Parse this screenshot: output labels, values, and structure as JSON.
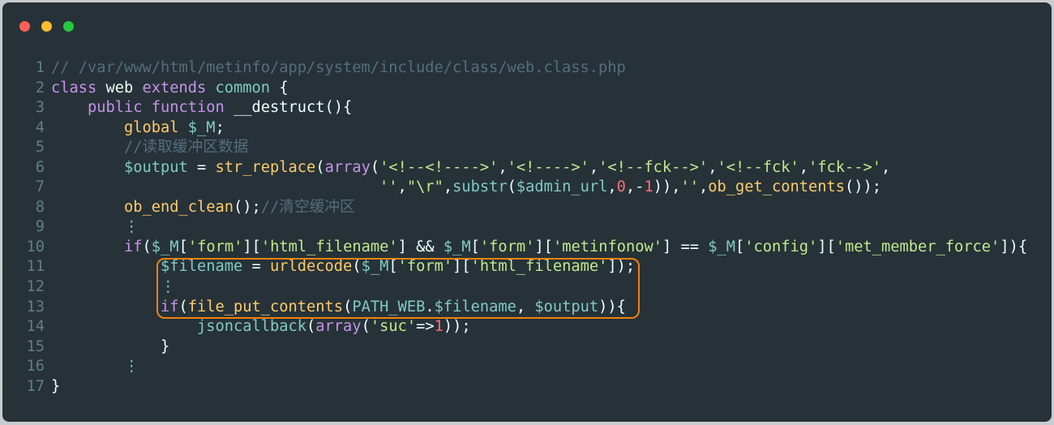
{
  "window": {
    "controls": [
      "close",
      "minimize",
      "maximize"
    ]
  },
  "colors": {
    "background": "#263238",
    "keyword": "#c792ea",
    "function": "#ffcb6b",
    "variable": "#80cbc4",
    "string": "#c3e88d",
    "number": "#f07178",
    "comment": "#546e7a",
    "highlight_box": "#f0820f"
  },
  "code": {
    "lines": [
      {
        "n": "1",
        "tokens": [
          [
            "cm",
            "// /var/www/html/metinfo/app/system/include/class/web.class.php"
          ]
        ]
      },
      {
        "n": "2",
        "tokens": [
          [
            "kw",
            "class"
          ],
          [
            "tx",
            " web "
          ],
          [
            "kw",
            "extends"
          ],
          [
            "vr",
            " common"
          ],
          [
            "tx",
            " {"
          ]
        ]
      },
      {
        "n": "3",
        "tokens": [
          [
            "tx",
            "    "
          ],
          [
            "kw",
            "public function"
          ],
          [
            "tx",
            " __destruct(){"
          ]
        ]
      },
      {
        "n": "4",
        "tokens": [
          [
            "tx",
            "        "
          ],
          [
            "fn",
            "global"
          ],
          [
            "tx",
            " "
          ],
          [
            "vr",
            "$_M"
          ],
          [
            "tx",
            ";"
          ]
        ]
      },
      {
        "n": "5",
        "tokens": [
          [
            "tx",
            "        "
          ],
          [
            "cm",
            "//读取缓冲区数据"
          ]
        ]
      },
      {
        "n": "6",
        "tokens": [
          [
            "tx",
            "        "
          ],
          [
            "vr",
            "$output"
          ],
          [
            "tx",
            " = "
          ],
          [
            "fn",
            "str_replace"
          ],
          [
            "tx",
            "("
          ],
          [
            "kw",
            "array"
          ],
          [
            "tx",
            "("
          ],
          [
            "st",
            "'<!--<!---->'"
          ],
          [
            "tx",
            ","
          ],
          [
            "st",
            "'<!---->'"
          ],
          [
            "tx",
            ","
          ],
          [
            "st",
            "'<!--fck-->'"
          ],
          [
            "tx",
            ","
          ],
          [
            "st",
            "'<!--fck'"
          ],
          [
            "tx",
            ","
          ],
          [
            "st",
            "'fck-->'"
          ],
          [
            "tx",
            ","
          ]
        ]
      },
      {
        "n": "7",
        "tokens": [
          [
            "tx",
            "                                    "
          ],
          [
            "st",
            "''"
          ],
          [
            "tx",
            ","
          ],
          [
            "st",
            "\"\\r\""
          ],
          [
            "tx",
            ","
          ],
          [
            "vr",
            "substr"
          ],
          [
            "tx",
            "("
          ],
          [
            "vr",
            "$admin_url"
          ],
          [
            "tx",
            ","
          ],
          [
            "nm",
            "0"
          ],
          [
            "tx",
            ",-"
          ],
          [
            "nm",
            "1"
          ],
          [
            "tx",
            ")),"
          ],
          [
            "st",
            "''"
          ],
          [
            "tx",
            ","
          ],
          [
            "fn",
            "ob_get_contents"
          ],
          [
            "tx",
            "());"
          ]
        ]
      },
      {
        "n": "8",
        "tokens": [
          [
            "tx",
            "        "
          ],
          [
            "fn",
            "ob_end_clean"
          ],
          [
            "tx",
            "();"
          ],
          [
            "cm",
            "//清空缓冲区"
          ]
        ]
      },
      {
        "n": "9",
        "tokens": [
          [
            "tx",
            "        "
          ],
          [
            "vr",
            "⋮"
          ]
        ]
      },
      {
        "n": "10",
        "tokens": [
          [
            "tx",
            "        "
          ],
          [
            "kw",
            "if"
          ],
          [
            "tx",
            "("
          ],
          [
            "vr",
            "$_M"
          ],
          [
            "tx",
            "["
          ],
          [
            "st",
            "'form'"
          ],
          [
            "tx",
            "]["
          ],
          [
            "st",
            "'html_filename'"
          ],
          [
            "tx",
            "] && "
          ],
          [
            "vr",
            "$_M"
          ],
          [
            "tx",
            "["
          ],
          [
            "st",
            "'form'"
          ],
          [
            "tx",
            "]["
          ],
          [
            "st",
            "'metinfonow'"
          ],
          [
            "tx",
            "] == "
          ],
          [
            "vr",
            "$_M"
          ],
          [
            "tx",
            "["
          ],
          [
            "st",
            "'config'"
          ],
          [
            "tx",
            "]["
          ],
          [
            "st",
            "'met_member_force'"
          ],
          [
            "tx",
            "]){"
          ]
        ]
      },
      {
        "n": "11",
        "tokens": [
          [
            "tx",
            "            "
          ],
          [
            "vr",
            "$filename"
          ],
          [
            "tx",
            " = "
          ],
          [
            "fn",
            "urldecode"
          ],
          [
            "tx",
            "("
          ],
          [
            "vr",
            "$_M"
          ],
          [
            "tx",
            "["
          ],
          [
            "st",
            "'form'"
          ],
          [
            "tx",
            "]["
          ],
          [
            "st",
            "'html_filename'"
          ],
          [
            "tx",
            "]);"
          ]
        ]
      },
      {
        "n": "12",
        "tokens": [
          [
            "tx",
            "            "
          ],
          [
            "vr",
            "⋮"
          ]
        ]
      },
      {
        "n": "13",
        "tokens": [
          [
            "tx",
            "            "
          ],
          [
            "kw",
            "if"
          ],
          [
            "tx",
            "("
          ],
          [
            "fn",
            "file_put_contents"
          ],
          [
            "tx",
            "("
          ],
          [
            "vr",
            "PATH_WEB"
          ],
          [
            "tx",
            "."
          ],
          [
            "vr",
            "$filename"
          ],
          [
            "tx",
            ", "
          ],
          [
            "vr",
            "$output"
          ],
          [
            "tx",
            ")){"
          ]
        ]
      },
      {
        "n": "14",
        "tokens": [
          [
            "tx",
            "                "
          ],
          [
            "vr",
            "jsoncallback"
          ],
          [
            "tx",
            "("
          ],
          [
            "kw",
            "array"
          ],
          [
            "tx",
            "("
          ],
          [
            "st",
            "'suc'"
          ],
          [
            "tx",
            "=>"
          ],
          [
            "nm",
            "1"
          ],
          [
            "tx",
            "));"
          ]
        ]
      },
      {
        "n": "15",
        "tokens": [
          [
            "tx",
            "            }"
          ]
        ]
      },
      {
        "n": "16",
        "tokens": [
          [
            "tx",
            "        "
          ],
          [
            "vr",
            "⋮"
          ]
        ]
      },
      {
        "n": "17",
        "tokens": [
          [
            "tx",
            "}"
          ]
        ]
      }
    ]
  }
}
